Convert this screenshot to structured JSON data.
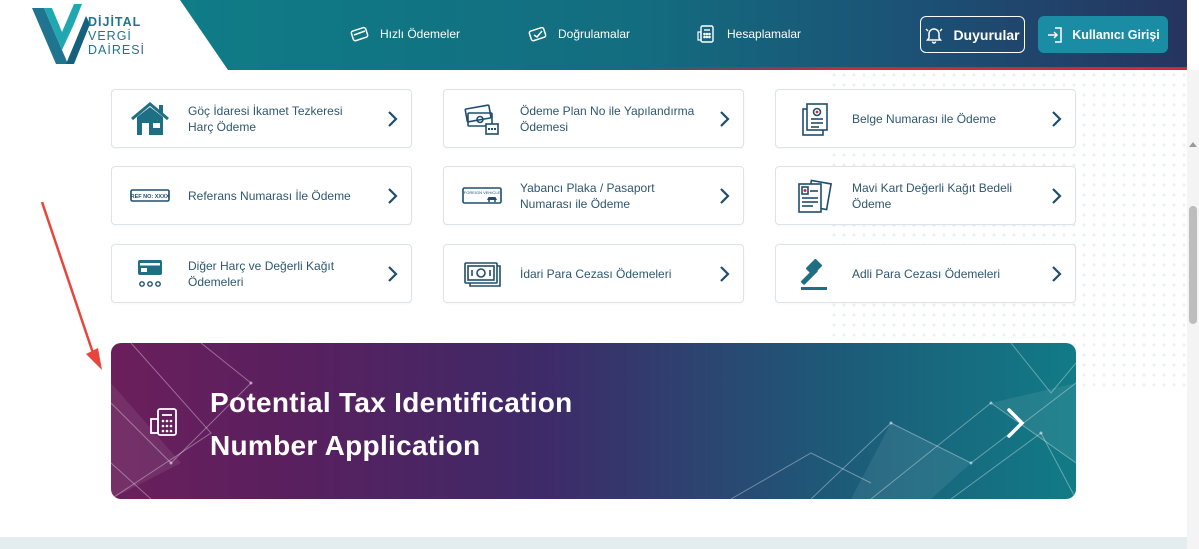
{
  "logo": {
    "line1": "DİJİTAL",
    "line2": "VERGİ",
    "line3": "DAİRESİ"
  },
  "nav": [
    {
      "label": "Hızlı Ödemeler",
      "icon": "card-icon"
    },
    {
      "label": "Doğrulamalar",
      "icon": "check-card-icon"
    },
    {
      "label": "Hesaplamalar",
      "icon": "calculator-icon"
    }
  ],
  "header_buttons": {
    "announcements": "Duyurular",
    "login": "Kullanıcı Girişi"
  },
  "cards": [
    {
      "label": "Göç İdaresi İkamet Tezkeresi Harç Ödeme",
      "icon": "house-icon"
    },
    {
      "label": "Ödeme Plan No ile Yapılandırma Ödemesi",
      "icon": "money-calendar-icon"
    },
    {
      "label": "Belge Numarası ile Ödeme",
      "icon": "document-stack-icon"
    },
    {
      "label": "Referans Numarası İle Ödeme",
      "icon": "ref-no-icon"
    },
    {
      "label": "Yabancı Plaka / Pasaport Numarası ile Ödeme",
      "icon": "foreign-plate-icon"
    },
    {
      "label": "Mavi Kart Değerli Kağıt Bedeli Ödeme",
      "icon": "blue-card-icon"
    },
    {
      "label": "Diğer Harç ve Değerli Kağıt Ödemeleri",
      "icon": "card-reader-icon"
    },
    {
      "label": "İdari Para Cezası Ödemeleri",
      "icon": "banknote-icon"
    },
    {
      "label": "Adli Para Cezası Ödemeleri",
      "icon": "gavel-icon"
    }
  ],
  "ref_badge": "REF NO: XXXX",
  "plate_badge": "FOREIGN VEHICLE",
  "banner": {
    "title_line1": "Potential Tax Identification",
    "title_line2": "Number Application"
  },
  "colors": {
    "teal": "#0f7c86",
    "navy": "#26345f",
    "accent_button": "#1a8da4",
    "card_text": "#2e5770",
    "annotation_arrow": "#e8453c"
  }
}
